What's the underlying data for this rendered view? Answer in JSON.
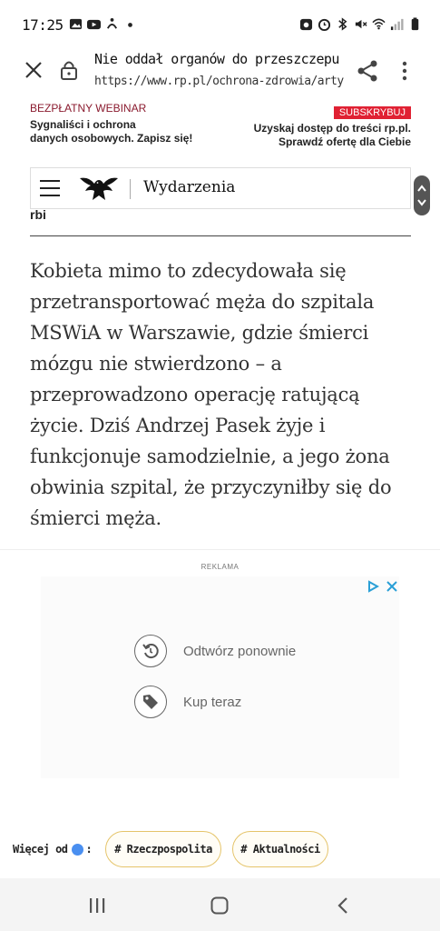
{
  "status_bar": {
    "time": "17:25",
    "left_icons": [
      "gallery-icon",
      "youtube-icon",
      "accessibility-icon",
      "dot-icon"
    ],
    "right_icons": [
      "rec-icon",
      "alarm-icon",
      "bluetooth-icon",
      "mute-icon",
      "wifi-icon",
      "signal-icon",
      "battery-icon"
    ]
  },
  "url_bar": {
    "page_title": "Nie oddał organów do przeszczepu",
    "url": "https://www.rp.pl/ochrona-zdrowia/artykul"
  },
  "promo": {
    "left_title": "BEZPŁATNY WEBINAR",
    "left_desc_line1": "Sygnaliści i ochrona",
    "left_desc_line2": "danych osobowych. Zapisz się!",
    "subscribe_label": "SUBSKRYBUJ",
    "right_desc_line1": "Uzyskaj dostęp do treści rp.pl.",
    "right_desc_line2": "Sprawdź ofertę dla Ciebie",
    "colors": {
      "accent": "#8a1a2e",
      "subscribe": "#e02133"
    }
  },
  "site_header": {
    "section": "Wydarzenia"
  },
  "partial_text": "rbi",
  "article": {
    "paragraph": "Kobieta mimo to zdecydowała się przetransportować męża do szpitala MSWiA w Warszawie, gdzie śmierci mózgu nie stwierdzono – a przeprowadzono operację ratującą życie. Dziś Andrzej Pasek żyje i funkcjonuje samodzielnie, a jego żona obwinia szpital, że przyczyniłby się do śmierci męża."
  },
  "ad": {
    "label": "REKLAMA",
    "replay_label": "Odtwórz ponownie",
    "buy_label": "Kup teraz"
  },
  "tags": {
    "more_from": "Więcej od",
    "items": [
      "# Rzeczpospolita",
      "# Aktualności"
    ],
    "colors": {
      "border": "#e5c46a"
    }
  },
  "nav_bar": {
    "buttons": [
      "recents-icon",
      "home-icon",
      "back-icon"
    ]
  }
}
